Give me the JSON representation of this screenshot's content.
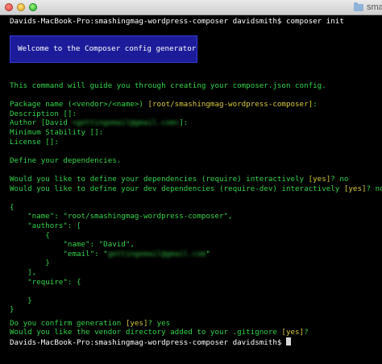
{
  "window": {
    "title": "sma"
  },
  "terminal": {
    "prompt": "Davids-MacBook-Pro:smashingmag-wordpress-composer davidsmith$ ",
    "command": "composer init",
    "banner": "Welcome to the Composer config generator",
    "intro": "This command will guide you through creating your composer.json config.",
    "package_name_label": "Package name (<vendor>/<name>) ",
    "package_name_default": "[root/smashingmag-wordpress-composer]",
    "package_name_suffix": ":",
    "description_line": "Description []:",
    "author_prefix": "Author [David ",
    "author_email_blurred": "<gettingemail@gmail.com>",
    "author_suffix": "]:",
    "min_stability_line": "Minimum Stability []:",
    "license_line": "License []:",
    "define_deps": "Define your dependencies.",
    "q_require_prefix": "Would you like to define your dependencies (require) interactively ",
    "q_require_default": "[yes]",
    "q_require_answer": "? no",
    "q_require_dev_prefix": "Would you like to define your dev dependencies (require-dev) interactively ",
    "q_require_dev_default": "[yes]",
    "q_require_dev_answer": "? no",
    "json_preview": [
      "{",
      "    \"name\": \"root/smashingmag-wordpress-composer\",",
      "    \"authors\": [",
      "        {",
      "            \"name\": \"David\",",
      "            \"email\": \"",
      "        }",
      "    ],",
      "    \"require\": {",
      "",
      "    }",
      "}"
    ],
    "json_email_blurred": "gettingemail@gmail.com",
    "json_email_suffix": "\"",
    "confirm_prefix": "Do you confirm generation ",
    "confirm_default": "[yes]",
    "confirm_answer": "? yes",
    "vendor_prefix": "Would you like the vendor directory added to your .gitignore ",
    "vendor_default": "[yes]",
    "vendor_answer": "?",
    "final_prompt": "Davids-MacBook-Pro:smashingmag-wordpress-composer davidsmith$ "
  },
  "colors": {
    "text": "#34d34a",
    "default_value": "#d7c93a",
    "banner_bg": "#1c1c9a",
    "background": "#000000"
  }
}
